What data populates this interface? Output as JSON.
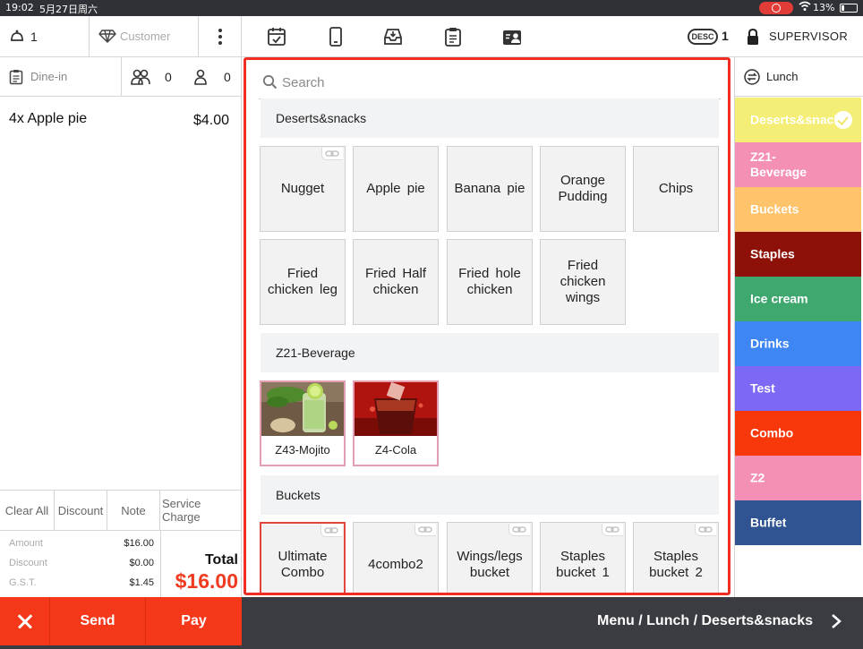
{
  "status": {
    "time": "19:02",
    "date": "5月27日周六",
    "battery": "13%"
  },
  "header": {
    "guest_count": "1",
    "customer_label": "Customer",
    "order_type": "Dine-in",
    "adult_count": "0",
    "child_count": "0",
    "desc_label": "DESC",
    "desc_count": "1",
    "user_role": "SUPERVISOR"
  },
  "order": {
    "items": [
      {
        "name": "4x Apple pie",
        "price": "$4.00"
      }
    ]
  },
  "actions": {
    "clear_all": "Clear All",
    "discount": "Discount",
    "note": "Note",
    "service_charge": "Service Charge"
  },
  "totals": {
    "amount_label": "Amount",
    "amount": "$16.00",
    "discount_label": "Discount",
    "discount": "$0.00",
    "gst_label": "G.S.T.",
    "gst": "$1.45",
    "total_label": "Total",
    "total": "$16.00"
  },
  "footer": {
    "send_label": "Send",
    "pay_label": "Pay",
    "breadcrumb": "Menu / Lunch / Deserts&snacks"
  },
  "toolbar_icons": [
    "calendar-check-icon",
    "mobile-icon",
    "inbox-tray-icon",
    "clipboard-list-icon",
    "user-badge-icon"
  ],
  "search": {
    "placeholder": "Search"
  },
  "menu": {
    "sections": [
      {
        "title": "Deserts&snacks",
        "items": [
          {
            "label": "Nugget",
            "linked": true
          },
          {
            "label": "Apple pie",
            "linked": false
          },
          {
            "label": "Banana pie",
            "linked": false
          },
          {
            "label": "Orange Pudding",
            "linked": false
          },
          {
            "label": "Chips",
            "linked": false
          },
          {
            "label": "Fried chicken leg",
            "linked": false
          },
          {
            "label": "Fried Half chicken",
            "linked": false
          },
          {
            "label": "Fried hole chicken",
            "linked": false
          },
          {
            "label": "Fried chicken wings",
            "linked": false
          }
        ]
      },
      {
        "title": "Z21-Beverage",
        "items": [
          {
            "label": "Z43-Mojito",
            "image": "mojito"
          },
          {
            "label": "Z4-Cola",
            "image": "cola"
          }
        ]
      },
      {
        "title": "Buckets",
        "items": [
          {
            "label": "Ultimate Combo",
            "linked": true
          },
          {
            "label": "4combo2",
            "linked": true
          },
          {
            "label": "Wings/legs bucket",
            "linked": true
          },
          {
            "label": "Staples bucket 1",
            "linked": true
          },
          {
            "label": "Staples bucket 2",
            "linked": true
          }
        ]
      }
    ]
  },
  "categories": {
    "header": "Lunch",
    "items": [
      {
        "label": "Deserts&snacks",
        "color": "#f4ed76",
        "selected": true
      },
      {
        "label": "Z21-Beverage",
        "color": "#f48fb5"
      },
      {
        "label": "Buckets",
        "color": "#ffc36b"
      },
      {
        "label": "Staples",
        "color": "#8e1109"
      },
      {
        "label": "Ice cream",
        "color": "#3fa86f"
      },
      {
        "label": "Drinks",
        "color": "#3f86f5"
      },
      {
        "label": "Test",
        "color": "#7b68f5"
      },
      {
        "label": "Combo",
        "color": "#f8380b"
      },
      {
        "label": "Z2",
        "color": "#f48fb5"
      },
      {
        "label": "Buffet",
        "color": "#2f5491"
      }
    ]
  },
  "colors": {
    "accent": "#f5381a",
    "frame": "#ef2d22",
    "footer": "#3a3c42"
  }
}
